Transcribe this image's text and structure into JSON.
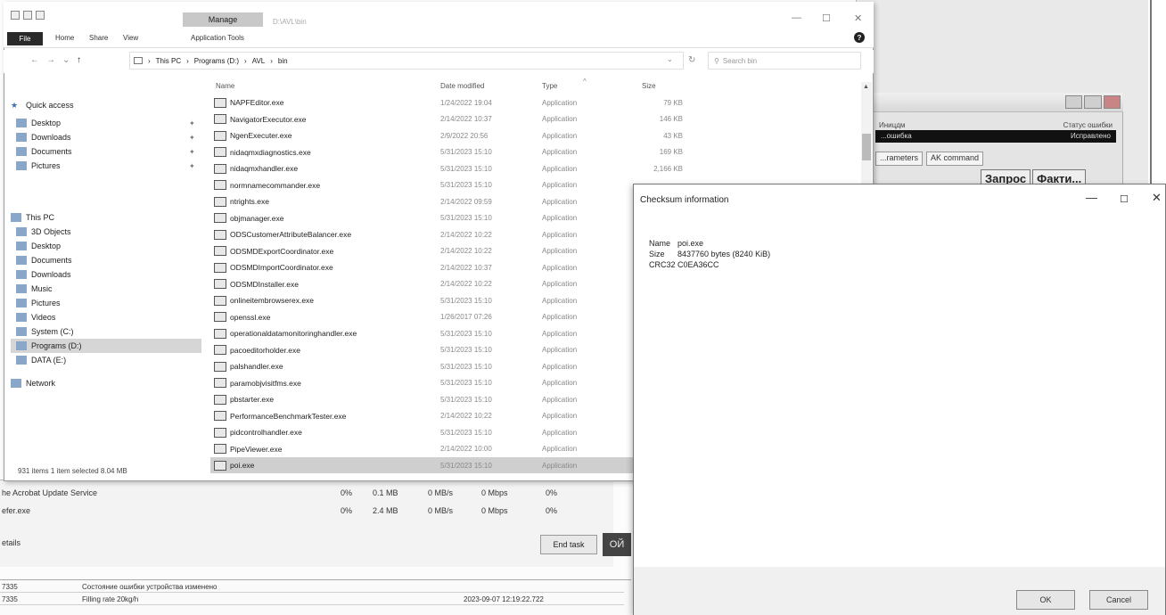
{
  "explorer": {
    "ribbon_context": "Manage",
    "window_title": "D:\\AVL\\bin",
    "tabs": [
      "File",
      "Home",
      "Share",
      "View",
      "Application Tools"
    ],
    "breadcrumb": [
      "This PC",
      "Programs (D:)",
      "AVL",
      "bin"
    ],
    "search_placeholder": "Search bin",
    "columns": {
      "name": "Name",
      "date": "Date modified",
      "type": "Type",
      "size": "Size"
    },
    "nav": [
      {
        "label": "Quick access",
        "icon": "star-icon"
      },
      {
        "label": "Desktop",
        "icon": "desktop-icon",
        "pinned": true
      },
      {
        "label": "Downloads",
        "icon": "download-icon",
        "pinned": true
      },
      {
        "label": "Documents",
        "icon": "document-icon",
        "pinned": true
      },
      {
        "label": "Pictures",
        "icon": "picture-icon",
        "pinned": true
      },
      {
        "label": "This PC",
        "icon": "computer-icon"
      },
      {
        "label": "3D Objects",
        "icon": "cube-icon"
      },
      {
        "label": "Desktop",
        "icon": "desktop-icon"
      },
      {
        "label": "Documents",
        "icon": "document-icon"
      },
      {
        "label": "Downloads",
        "icon": "download-icon"
      },
      {
        "label": "Music",
        "icon": "music-icon"
      },
      {
        "label": "Pictures",
        "icon": "picture-icon"
      },
      {
        "label": "Videos",
        "icon": "video-icon"
      },
      {
        "label": "System (C:)",
        "icon": "drive-icon"
      },
      {
        "label": "Programs (D:)",
        "icon": "drive-icon",
        "selected": true
      },
      {
        "label": "DATA (E:)",
        "icon": "drive-icon"
      },
      {
        "label": "Network",
        "icon": "network-icon"
      }
    ],
    "files": [
      {
        "name": "NAPFEditor.exe",
        "date": "1/24/2022 19:04",
        "type": "Application",
        "size": "79 KB"
      },
      {
        "name": "NavigatorExecutor.exe",
        "date": "2/14/2022 10:37",
        "type": "Application",
        "size": "146 KB"
      },
      {
        "name": "NgenExecuter.exe",
        "date": "2/9/2022 20:56",
        "type": "Application",
        "size": "43 KB"
      },
      {
        "name": "nidaqmxdiagnostics.exe",
        "date": "5/31/2023 15:10",
        "type": "Application",
        "size": "169 KB"
      },
      {
        "name": "nidaqmxhandler.exe",
        "date": "5/31/2023 15:10",
        "type": "Application",
        "size": "2,166 KB"
      },
      {
        "name": "normnamecommander.exe",
        "date": "5/31/2023 15:10",
        "type": "Application",
        "size": ""
      },
      {
        "name": "ntrights.exe",
        "date": "2/14/2022 09:59",
        "type": "Application",
        "size": ""
      },
      {
        "name": "objmanager.exe",
        "date": "5/31/2023 15:10",
        "type": "Application",
        "size": ""
      },
      {
        "name": "ODSCustomerAttributeBalancer.exe",
        "date": "2/14/2022 10:22",
        "type": "Application",
        "size": ""
      },
      {
        "name": "ODSMDExportCoordinator.exe",
        "date": "2/14/2022 10:22",
        "type": "Application",
        "size": ""
      },
      {
        "name": "ODSMDImportCoordinator.exe",
        "date": "2/14/2022 10:37",
        "type": "Application",
        "size": ""
      },
      {
        "name": "ODSMDInstaller.exe",
        "date": "2/14/2022 10:22",
        "type": "Application",
        "size": ""
      },
      {
        "name": "onlineitembrowserex.exe",
        "date": "5/31/2023 15:10",
        "type": "Application",
        "size": ""
      },
      {
        "name": "openssl.exe",
        "date": "1/26/2017 07:26",
        "type": "Application",
        "size": ""
      },
      {
        "name": "operationaldatamonitoringhandler.exe",
        "date": "5/31/2023 15:10",
        "type": "Application",
        "size": ""
      },
      {
        "name": "pacoeditorholder.exe",
        "date": "5/31/2023 15:10",
        "type": "Application",
        "size": ""
      },
      {
        "name": "palshandler.exe",
        "date": "5/31/2023 15:10",
        "type": "Application",
        "size": ""
      },
      {
        "name": "paramobjvisitfms.exe",
        "date": "5/31/2023 15:10",
        "type": "Application",
        "size": ""
      },
      {
        "name": "pbstarter.exe",
        "date": "5/31/2023 15:10",
        "type": "Application",
        "size": ""
      },
      {
        "name": "PerformanceBenchmarkTester.exe",
        "date": "2/14/2022 10:22",
        "type": "Application",
        "size": ""
      },
      {
        "name": "pidcontrolhandler.exe",
        "date": "5/31/2023 15:10",
        "type": "Application",
        "size": ""
      },
      {
        "name": "PipeViewer.exe",
        "date": "2/14/2022 10:00",
        "type": "Application",
        "size": ""
      },
      {
        "name": "poi.exe",
        "date": "5/31/2023 15:10",
        "type": "Application",
        "size": "",
        "selected": true
      }
    ],
    "status": "931 items    1 item selected  8.04 MB"
  },
  "task_manager": {
    "rows": [
      {
        "name": "he Acrobat Update Service",
        "cpu": "0%",
        "mem": "0.1 MB",
        "disk": "0 MB/s",
        "net": "0 Mbps",
        "gpu": "0%"
      },
      {
        "name": "efer.exe",
        "cpu": "0%",
        "mem": "2.4 MB",
        "disk": "0 MB/s",
        "net": "0 Mbps",
        "gpu": "0%"
      }
    ],
    "details": "etails",
    "end_task": "End task",
    "fragment": "ОЙ"
  },
  "event_log": [
    {
      "id": "7335",
      "text": "Состояние ошибки устройства изменено",
      "time": ""
    },
    {
      "id": "7335",
      "text": "Filling rate 20kg/h",
      "time": "2023-09-07 12:19:22.722"
    }
  ],
  "bg_window": {
    "col1": "Иницдм",
    "col2": "Статус ошибки",
    "row_left": "...ошибка",
    "row_right": "Исправлено",
    "tabs": [
      "...rameters",
      "AK command"
    ],
    "buttons": [
      "Запрос",
      "Факти..."
    ]
  },
  "checksum": {
    "title": "Checksum information",
    "name_label": "Name",
    "name_value": "poi.exe",
    "size_label": "Size",
    "size_value": "8437760 bytes (8240 KiB)",
    "crc_label": "CRC32",
    "crc_value": "C0EA36CC",
    "ok": "OK",
    "cancel": "Cancel"
  }
}
